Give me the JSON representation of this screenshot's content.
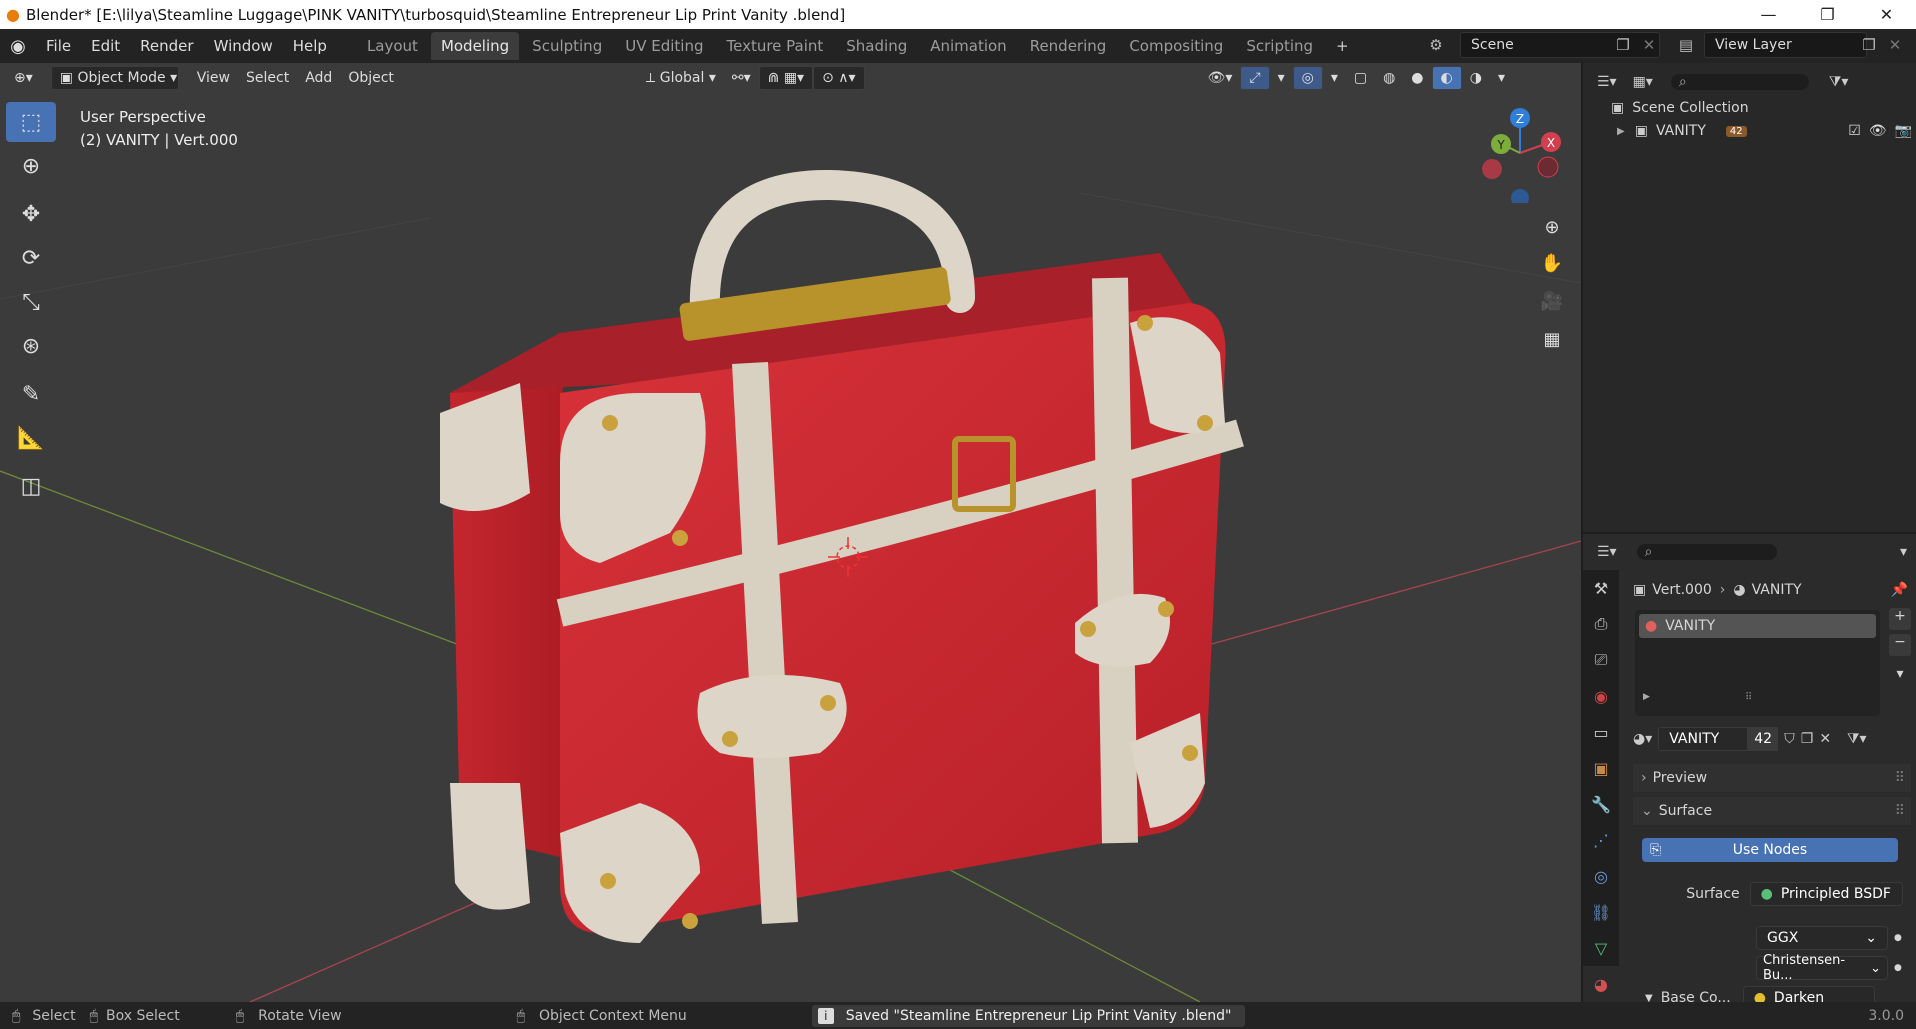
{
  "window": {
    "title": "Blender* [E:\\lilya\\Steamline Luggage\\PINK VANITY\\turbosquid\\Steamline Entrepreneur Lip Print  Vanity .blend]",
    "minimize": "—",
    "restore": "❐",
    "close": "✕"
  },
  "menus": [
    "File",
    "Edit",
    "Render",
    "Window",
    "Help"
  ],
  "workspaces": [
    "Layout",
    "Modeling",
    "Sculpting",
    "UV Editing",
    "Texture Paint",
    "Shading",
    "Animation",
    "Rendering",
    "Compositing",
    "Scripting"
  ],
  "active_workspace": "Modeling",
  "add_tab": "+",
  "scene": "Scene",
  "view_layer": "View Layer",
  "viewport": {
    "mode": "Object Mode",
    "menus": [
      "View",
      "Select",
      "Add",
      "Object"
    ],
    "orientation": "Global",
    "overlay_line1": "User Perspective",
    "overlay_line2": "(2)  VANITY | Vert.000",
    "gizmo": {
      "z": "Z",
      "y": "Y",
      "x": "X"
    },
    "colors": {
      "x_axis": "#d2404f",
      "y_axis": "#7dad3a",
      "z_axis": "#2f7ed8",
      "suitcase_red": "#c8262e",
      "strap": "#d8d0c0",
      "brass": "#b8922a"
    }
  },
  "outliner": {
    "root": "Scene Collection",
    "collection": "VANITY",
    "object_badge": "42"
  },
  "properties": {
    "breadcrumb_object": "Vert.000",
    "breadcrumb_material": "VANITY",
    "slot_name": "VANITY",
    "material_name": "VANITY",
    "material_users": "42",
    "panel_preview": "Preview",
    "panel_surface": "Surface",
    "use_nodes": "Use Nodes",
    "surface_label": "Surface",
    "surface_value": "Principled BSDF",
    "distribution": "GGX",
    "subsurface": "Christensen-Bu...",
    "base_color_label": "Base Co...",
    "base_color_value": "Darken"
  },
  "status": {
    "select": "Select",
    "box_select": "Box Select",
    "rotate_view": "Rotate View",
    "context_menu": "Object Context Menu",
    "message": "Saved \"Steamline Entrepreneur Lip Print  Vanity .blend\"",
    "version": "3.0.0"
  }
}
